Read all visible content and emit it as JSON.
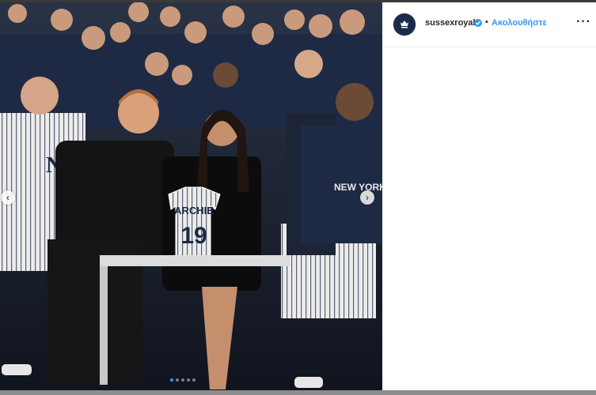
{
  "header": {
    "username": "sussexroyal",
    "bullet": "•",
    "follow_label": "Ακολουθήστε",
    "more_label": "···",
    "avatar_icon": "crown-monogram-icon",
    "verified_icon": "verified-badge-icon"
  },
  "photo": {
    "jersey_name": "ARCHIE",
    "jersey_number": "19",
    "shirt_text": "NEW YORK",
    "slide_count": 5,
    "active_slide": 1
  },
  "colors": {
    "accent": "#3897f0",
    "navy": "#1b2a4a"
  }
}
